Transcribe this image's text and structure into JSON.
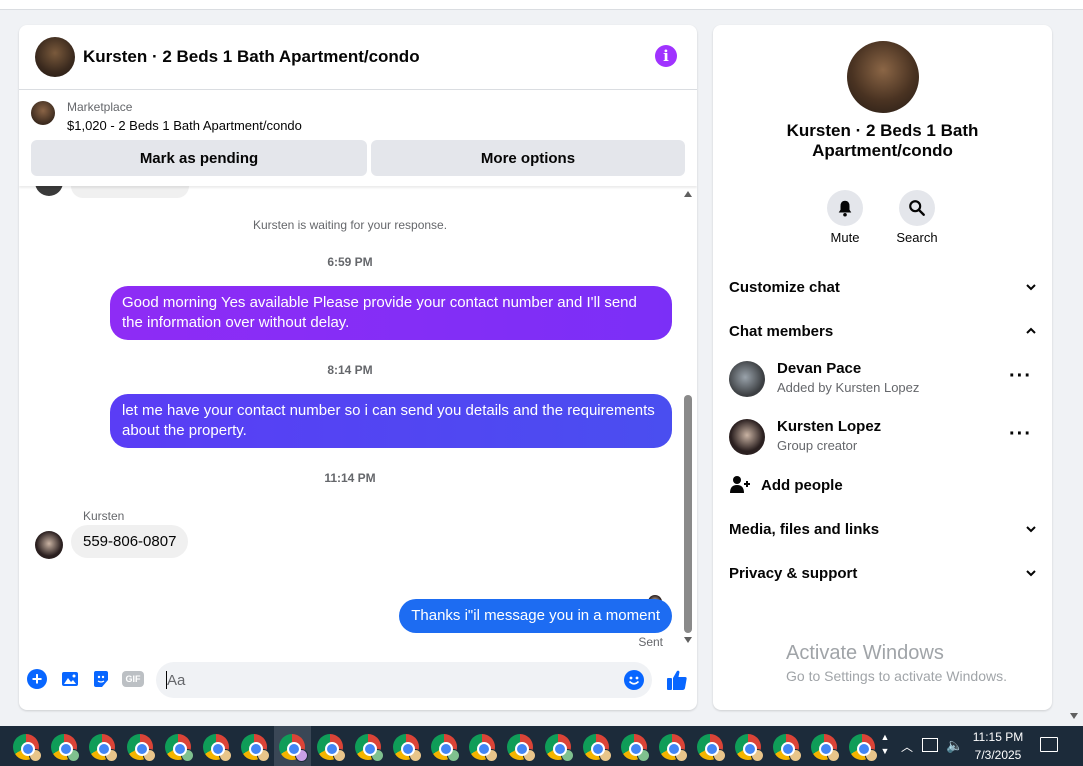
{
  "conversation": {
    "title": "Kursten · 2 Beds 1 Bath Apartment/condo",
    "info_icon": "info-icon"
  },
  "marketplace": {
    "label": "Marketplace",
    "listing": "$1,020 - 2 Beds 1 Bath Apartment/condo",
    "pending_label": "Mark as pending",
    "more_label": "More options"
  },
  "messages": {
    "system_note": "Kursten is waiting for your response.",
    "time1": "6:59 PM",
    "msg1": "Good morning Yes available Please provide your contact number and I'll send the information over without delay.",
    "time2": "8:14 PM",
    "msg2": "let me have your contact number so i can send you details and the requirements about the property.",
    "time3": "11:14 PM",
    "incoming_sender": "Kursten",
    "incoming_text": "559-806-0807",
    "msg3": "Thanks i\"il message you in a moment",
    "status": "Sent"
  },
  "composer": {
    "placeholder": "Aa",
    "gif_label": "GIF"
  },
  "info_panel": {
    "name": "Kursten · 2 Beds 1 Bath Apartment/condo",
    "mute_label": "Mute",
    "search_label": "Search",
    "customize_chat": "Customize chat",
    "chat_members": "Chat members",
    "members": [
      {
        "name": "Devan Pace",
        "sub": "Added by Kursten Lopez"
      },
      {
        "name": "Kursten Lopez",
        "sub": "Group creator"
      }
    ],
    "add_people": "Add people",
    "media": "Media, files and links",
    "privacy": "Privacy & support"
  },
  "watermark": {
    "line1": "Activate Windows",
    "line2": "Go to Settings to activate Windows."
  },
  "taskbar": {
    "time": "11:15 PM",
    "date": "7/3/2025"
  },
  "colors": {
    "accent": "#0866ff",
    "bubble_purple": "#8e2cf5",
    "bubble_indigo": "#5a3df5",
    "bubble_blue": "#1d6cf2",
    "info_purple": "#a033ff"
  }
}
